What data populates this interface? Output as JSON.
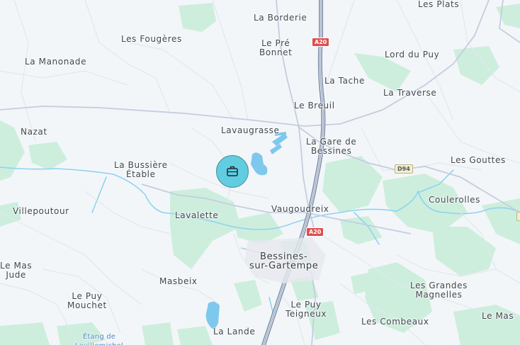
{
  "map": {
    "places": [
      {
        "id": "les-plats",
        "name": "Les Plats"
      },
      {
        "id": "la-borderie",
        "name": "La Borderie"
      },
      {
        "id": "le-pre-bonnet",
        "name": "Le Pré\nBonnet"
      },
      {
        "id": "les-fougeres",
        "name": "Les Fougères"
      },
      {
        "id": "lord-du-puy",
        "name": "Lord du Puy"
      },
      {
        "id": "la-manonade",
        "name": "La Manonade"
      },
      {
        "id": "la-tache",
        "name": "La Tache"
      },
      {
        "id": "la-traverse",
        "name": "La Traverse"
      },
      {
        "id": "le-breuil",
        "name": "Le Breuil"
      },
      {
        "id": "nazat",
        "name": "Nazat"
      },
      {
        "id": "lavaugrasse",
        "name": "Lavaugrasse"
      },
      {
        "id": "la-gare-de-bessines",
        "name": "La Gare de\nBessines"
      },
      {
        "id": "la-bussiere-etable",
        "name": "La Bussière\nÉtable"
      },
      {
        "id": "les-gouttes",
        "name": "Les Gouttes"
      },
      {
        "id": "villepoutour",
        "name": "Villepoutour"
      },
      {
        "id": "lavalette",
        "name": "Lavalette"
      },
      {
        "id": "vaugoudreix",
        "name": "Vaugoudreix"
      },
      {
        "id": "coulerolles",
        "name": "Coulerolles"
      },
      {
        "id": "bessines-sur-gartempe",
        "name": "Bessines-\nsur-Gartempe"
      },
      {
        "id": "le-mas-jude",
        "name": "Le Mas\nJude"
      },
      {
        "id": "masbeix",
        "name": "Masbeix"
      },
      {
        "id": "le-puy-mouchet",
        "name": "Le Puy\nMouchet"
      },
      {
        "id": "le-puy-teigneux",
        "name": "Le Puy\nTeigneux"
      },
      {
        "id": "les-grandes-magnelles",
        "name": "Les Grandes\nMagnelles"
      },
      {
        "id": "le-mas",
        "name": "Le Mas"
      },
      {
        "id": "les-combeaux",
        "name": "Les Combeaux"
      },
      {
        "id": "la-lande",
        "name": "La Lande"
      }
    ],
    "water_labels": [
      {
        "id": "etang-de-lavillemichel",
        "name": "Étang de\nLavillemichel"
      }
    ],
    "road_shields": [
      {
        "id": "a20-north",
        "ref": "A20",
        "style": "red"
      },
      {
        "id": "d94",
        "ref": "D94",
        "style": "d"
      },
      {
        "id": "a20-south",
        "ref": "A20",
        "style": "red"
      }
    ],
    "marker": {
      "icon": "briefcase-icon",
      "color": "#60cde0"
    },
    "colors": {
      "background": "#f3f6f8",
      "forest": "#cdeedd",
      "water": "#7ec8ee",
      "motorway": "#7d8ea8",
      "road": "#c4cde0"
    }
  }
}
